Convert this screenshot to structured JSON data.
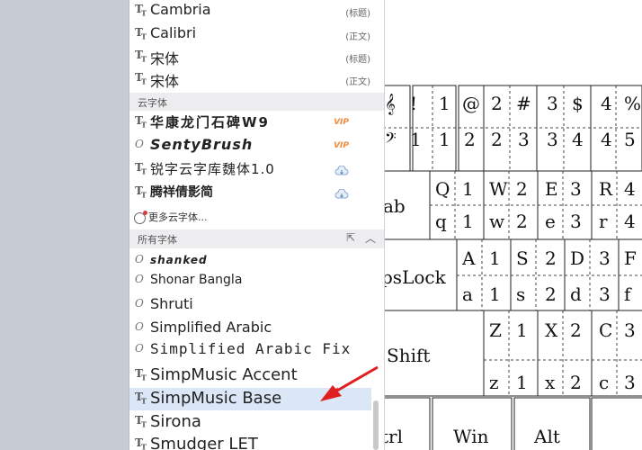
{
  "fonts_top": [
    {
      "name": "Cambria",
      "tag": "(标题)"
    },
    {
      "name": "Calibri",
      "tag": "(正文)"
    },
    {
      "name": "宋体",
      "tag": "(标题)"
    },
    {
      "name": "宋体",
      "tag": "(正文)"
    }
  ],
  "cloud_section": {
    "title": "云字体"
  },
  "cloud_fonts": [
    {
      "name": "华康龙门石碑W9",
      "badge": "VIP"
    },
    {
      "name": "SentyBrush",
      "badge": "VIP"
    },
    {
      "name": "锐字云字库魏体1.0"
    },
    {
      "name": "腾祥倩影简"
    }
  ],
  "more_cloud": "更多云字体...",
  "all_section": {
    "title": "所有字体"
  },
  "all_fonts": [
    {
      "name": "shanked"
    },
    {
      "name": "Shonar Bangla"
    },
    {
      "name": "Shruti"
    },
    {
      "name": "Simplified Arabic"
    },
    {
      "name": "Simplified Arabic Fix"
    },
    {
      "name": "SimpMusic Accent"
    },
    {
      "name": "SimpMusic Base",
      "selected": true
    },
    {
      "name": "Sirona"
    },
    {
      "name": "Smudger LET"
    }
  ],
  "keyboard": {
    "keys_tab": "ab",
    "keys_caps": "psLock",
    "keys_shift": "Shift",
    "keys_ctrl": "trl",
    "keys_win": "Win",
    "keys_alt": "Alt",
    "row1_top": [
      "𝄞",
      "!",
      "1",
      "@",
      "2",
      "#",
      "3",
      "$",
      "4",
      "%"
    ],
    "row1_bot": [
      "𝄢",
      "1",
      "1",
      "2",
      "2",
      "3",
      "3",
      "4",
      "4",
      "5"
    ],
    "row2_top": [
      "Q",
      "1",
      "W",
      "2",
      "E",
      "3",
      "R",
      "4"
    ],
    "row2_bot": [
      "q",
      "1",
      "w",
      "2",
      "e",
      "3",
      "r",
      "4"
    ],
    "row3_top": [
      "A",
      "1",
      "S",
      "2",
      "D",
      "3",
      "F"
    ],
    "row3_bot": [
      "a",
      "1",
      "s",
      "2",
      "d",
      "3",
      "f"
    ],
    "row4_top": [
      "Z",
      "1",
      "X",
      "2",
      "C",
      "3"
    ],
    "row4_bot": [
      "z",
      "1",
      "x",
      "2",
      "c",
      "3"
    ]
  }
}
